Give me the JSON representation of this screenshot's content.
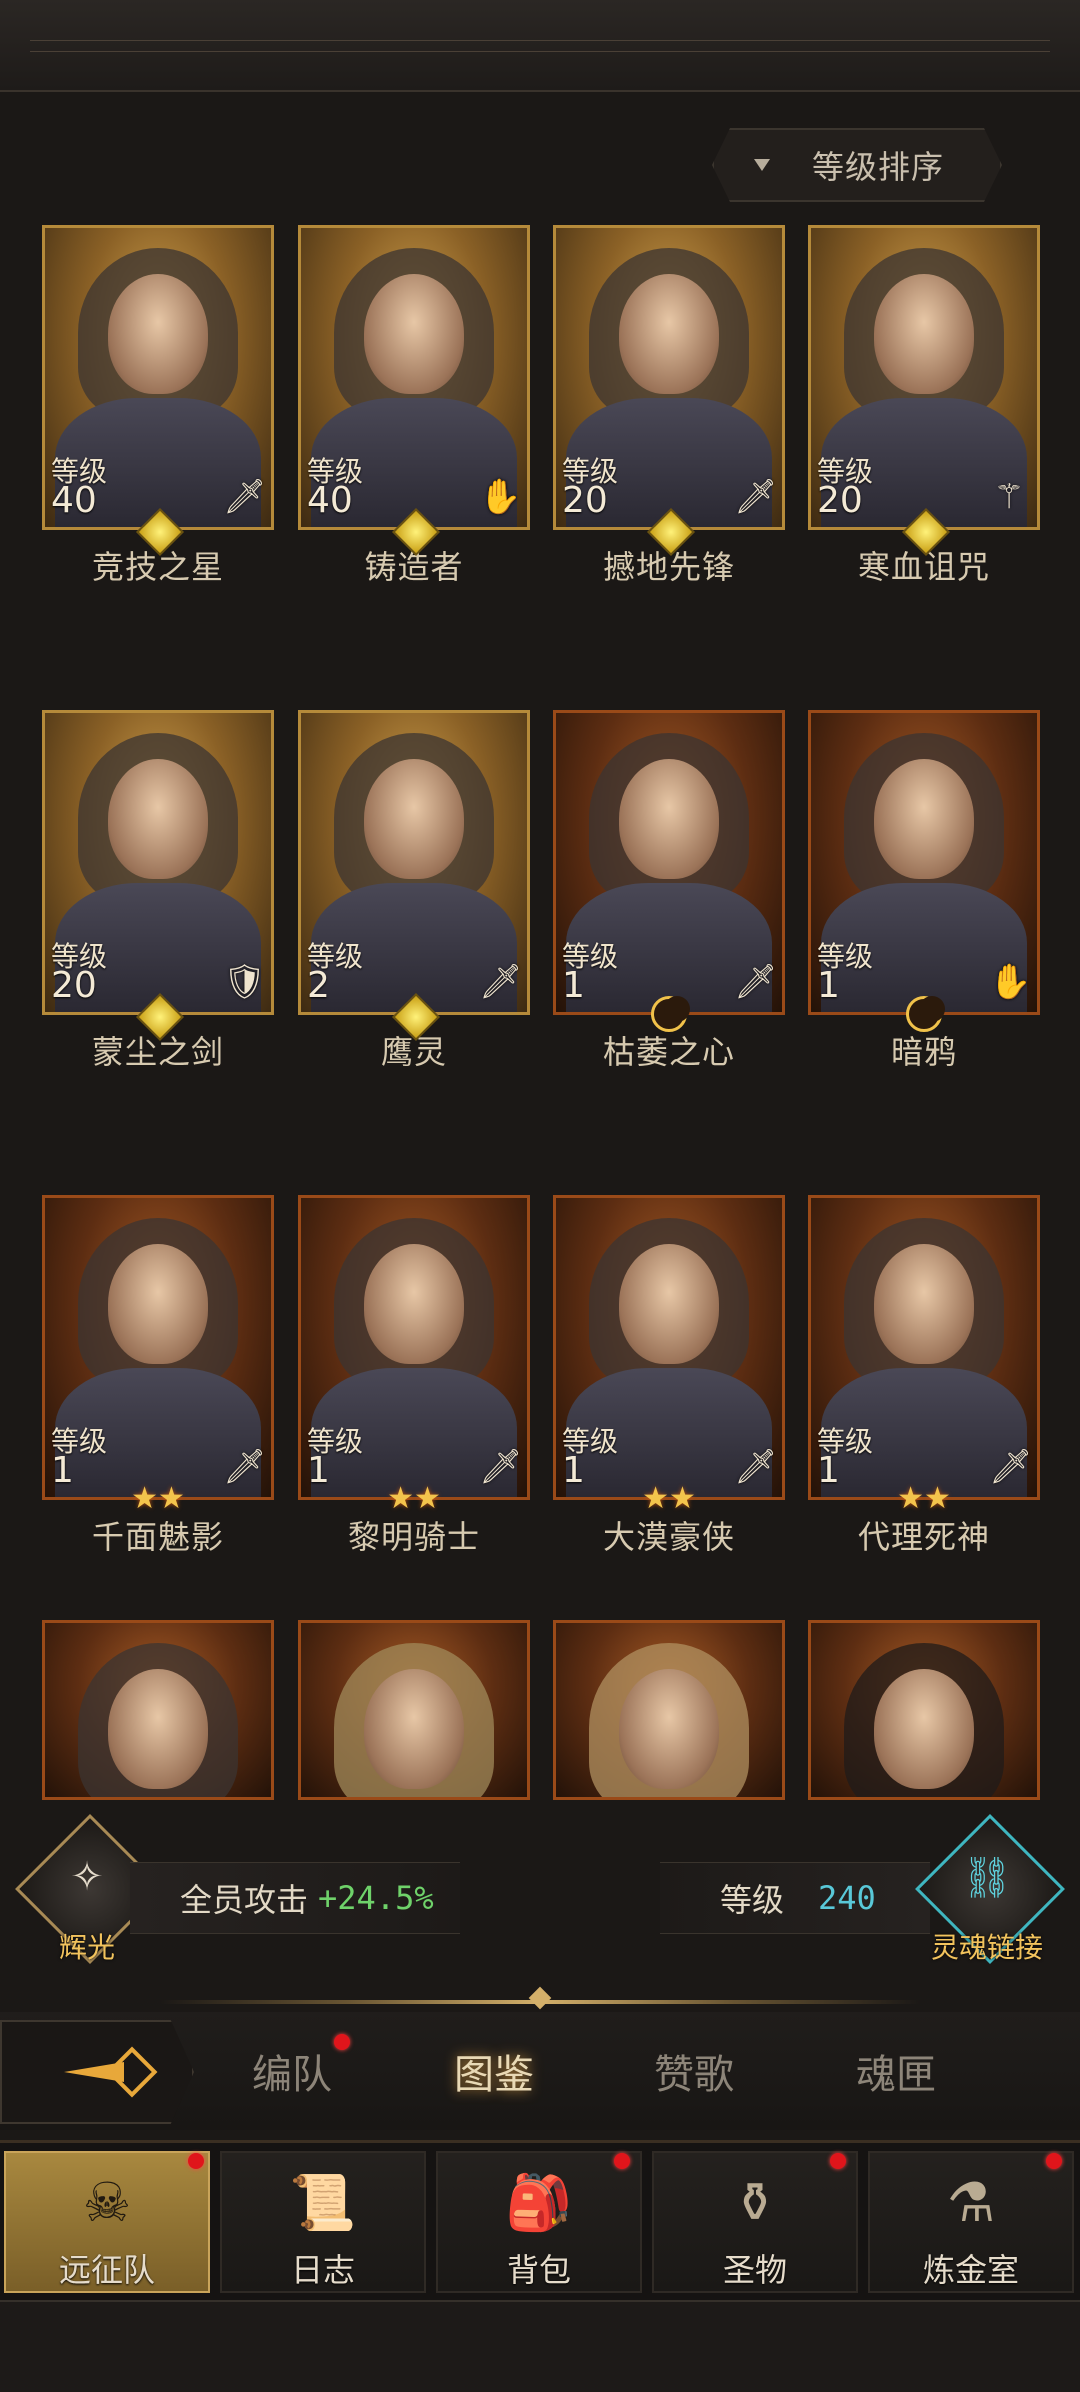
{
  "header": {
    "sort_label": "等级排序"
  },
  "heroes": [
    {
      "name": "竞技之星",
      "level_label": "等级",
      "level": "40",
      "class_icon": "sword-icon",
      "badge": "gem",
      "frame": "gold"
    },
    {
      "name": "铸造者",
      "level_label": "等级",
      "level": "40",
      "class_icon": "hand-icon",
      "badge": "gem",
      "frame": "gold"
    },
    {
      "name": "撼地先锋",
      "level_label": "等级",
      "level": "20",
      "class_icon": "sword-icon",
      "badge": "gem",
      "frame": "gold"
    },
    {
      "name": "寒血诅咒",
      "level_label": "等级",
      "level": "20",
      "class_icon": "staff-icon",
      "badge": "gem",
      "frame": "gold"
    },
    {
      "name": "蒙尘之剑",
      "level_label": "等级",
      "level": "20",
      "class_icon": "shield-icon",
      "badge": "gem",
      "frame": "gold"
    },
    {
      "name": "鹰灵",
      "level_label": "等级",
      "level": "2",
      "class_icon": "sword-icon",
      "badge": "gem",
      "frame": "gold"
    },
    {
      "name": "枯萎之心",
      "level_label": "等级",
      "level": "1",
      "class_icon": "sword-icon",
      "badge": "moon",
      "frame": "orange"
    },
    {
      "name": "暗鸦",
      "level_label": "等级",
      "level": "1",
      "class_icon": "hand-icon",
      "badge": "moon",
      "frame": "orange"
    },
    {
      "name": "千面魅影",
      "level_label": "等级",
      "level": "1",
      "class_icon": "sword-icon",
      "badge": "stars",
      "frame": "orange"
    },
    {
      "name": "黎明骑士",
      "level_label": "等级",
      "level": "1",
      "class_icon": "sword-icon",
      "badge": "stars",
      "frame": "orange"
    },
    {
      "name": "大漠豪侠",
      "level_label": "等级",
      "level": "1",
      "class_icon": "sword-icon",
      "badge": "stars",
      "frame": "orange"
    },
    {
      "name": "代理死神",
      "level_label": "等级",
      "level": "1",
      "class_icon": "sword-icon",
      "badge": "stars",
      "frame": "orange"
    }
  ],
  "stats": {
    "left_emblem_label": "辉光",
    "attack_label": "全员攻击",
    "attack_value": "+24.5%",
    "level_label": "等级",
    "level_value": "240",
    "right_emblem_label": "灵魂链接"
  },
  "tabs": [
    {
      "label": "编队",
      "badge": true
    },
    {
      "label": "图鉴",
      "active": true
    },
    {
      "label": "赞歌"
    },
    {
      "label": "魂匣"
    }
  ],
  "nav": [
    {
      "label": "远征队",
      "icon": "helmet-icon",
      "active": true,
      "badge": true
    },
    {
      "label": "日志",
      "icon": "scroll-icon",
      "badge": false
    },
    {
      "label": "背包",
      "icon": "bag-icon",
      "badge": true
    },
    {
      "label": "圣物",
      "icon": "relic-icon",
      "badge": true
    },
    {
      "label": "炼金室",
      "icon": "alchemy-icon",
      "badge": true
    }
  ],
  "colors": {
    "accent_gold": "#d4b06a",
    "stat_green": "#6fd26a",
    "stat_cyan": "#59c8d8",
    "badge_red": "#e0151b"
  }
}
